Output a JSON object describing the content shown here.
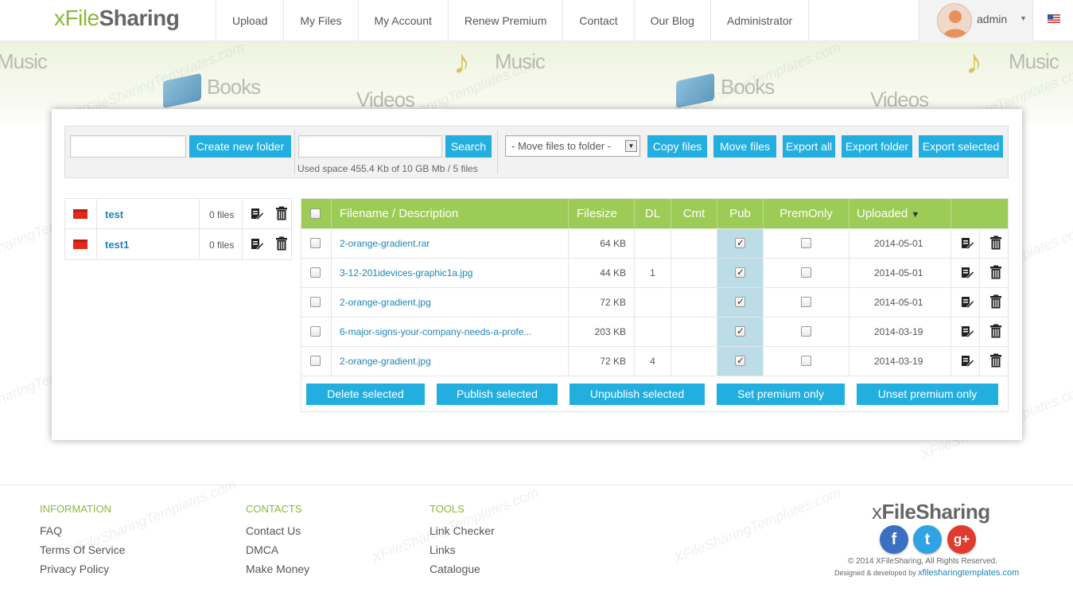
{
  "header": {
    "logo": {
      "part1": "xFile",
      "part2": "Sharing"
    },
    "nav": [
      "Upload",
      "My Files",
      "My Account",
      "Renew Premium",
      "Contact",
      "Our Blog",
      "Administrator"
    ],
    "user": "admin"
  },
  "banner": {
    "words": [
      "Music",
      "Books",
      "Videos",
      "Music",
      "Books",
      "Videos",
      "Music"
    ]
  },
  "toolbar": {
    "create_folder_label": "Create new folder",
    "search_label": "Search",
    "used_space": "Used space 455.4 Kb of 10 GB Mb / 5 files",
    "move_select": "- Move files to folder -",
    "copy_files": "Copy files",
    "move_files": "Move files",
    "export_all": "Export all",
    "export_folder": "Export folder",
    "export_selected": "Export selected"
  },
  "folders": [
    {
      "name": "test",
      "count": "0 files"
    },
    {
      "name": "test1",
      "count": "0 files"
    }
  ],
  "table": {
    "headers": {
      "filename": "Filename / Description",
      "filesize": "Filesize",
      "dl": "DL",
      "cmt": "Cmt",
      "pub": "Pub",
      "premonly": "PremOnly",
      "uploaded": "Uploaded"
    },
    "rows": [
      {
        "name": "2-orange-gradient.rar",
        "size": "64 KB",
        "dl": "",
        "cmt": "",
        "date": "2014-05-01"
      },
      {
        "name": "3-12-201idevices-graphic1a.jpg",
        "size": "44 KB",
        "dl": "1",
        "cmt": "",
        "date": "2014-05-01"
      },
      {
        "name": "2-orange-gradient.jpg",
        "size": "72 KB",
        "dl": "",
        "cmt": "",
        "date": "2014-05-01"
      },
      {
        "name": "6-major-signs-your-company-needs-a-profe...",
        "size": "203 KB",
        "dl": "",
        "cmt": "",
        "date": "2014-03-19"
      },
      {
        "name": "2-orange-gradient.jpg",
        "size": "72 KB",
        "dl": "4",
        "cmt": "",
        "date": "2014-03-19"
      }
    ],
    "bulk": {
      "delete": "Delete selected",
      "publish": "Publish selected",
      "unpublish": "Unpublish selected",
      "set_premium": "Set premium only",
      "unset_premium": "Unset premium only"
    }
  },
  "footer": {
    "information": {
      "title": "INFORMATION",
      "links": [
        "FAQ",
        "Terms Of Service",
        "Privacy Policy"
      ]
    },
    "contacts": {
      "title": "CONTACTS",
      "links": [
        "Contact Us",
        "DMCA",
        "Make Money"
      ]
    },
    "tools": {
      "title": "TOOLS",
      "links": [
        "Link Checker",
        "Links",
        "Catalogue"
      ]
    },
    "logo": {
      "part1": "x",
      "part2": "FileSharing"
    },
    "social": {
      "facebook": "f",
      "twitter": "t",
      "google": "g+"
    },
    "copyright": "© 2014 XFileSharing, All Rights Reserved.",
    "designed_prefix": "Designed & developed by",
    "designed_link": "xfilesharingtemplates.com"
  },
  "colors": {
    "accent": "#23aee0",
    "green": "#9ccb56",
    "link": "#1d86b5",
    "folder": "#e02b1b"
  }
}
